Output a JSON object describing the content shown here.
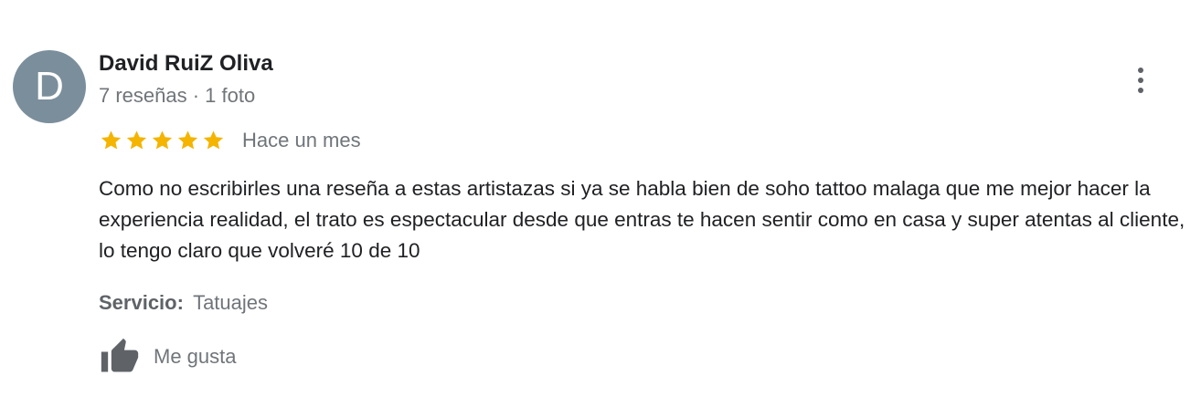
{
  "author": {
    "initial": "D",
    "name": "David RuiZ Oliva",
    "meta": "7 reseñas · 1 foto"
  },
  "more_icon": "more-vert-icon",
  "rating": {
    "stars": 5,
    "max": 5,
    "color": "#f4b400",
    "date": "Hace un mes"
  },
  "review": {
    "text": "Como no escribirles una reseña a estas artistazas  si ya se habla bien de soho tattoo malaga que me mejor hacer la experiencia realidad, el trato es espectacular desde que entras te hacen sentir como en casa y super atentas al cliente, lo tengo claro que volveré 10 de 10"
  },
  "service": {
    "label": "Servicio:",
    "value": "Tatuajes"
  },
  "like": {
    "icon": "thumbs-up-icon",
    "label": "Me gusta"
  },
  "colors": {
    "avatar": "#7b8e9c",
    "primary_text": "#202124",
    "secondary_text": "#70757a",
    "icon": "#5f6368"
  }
}
